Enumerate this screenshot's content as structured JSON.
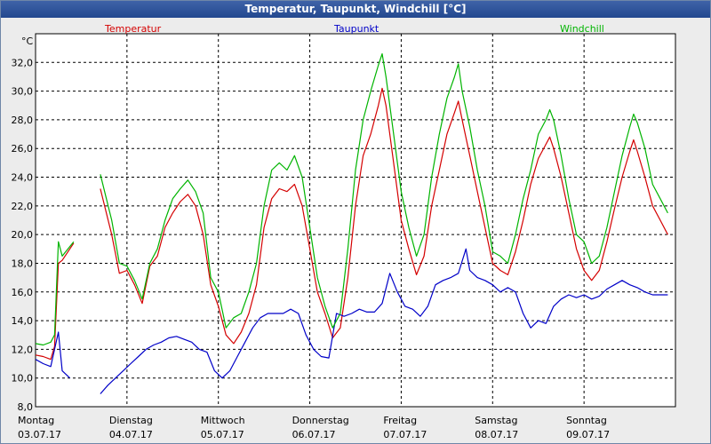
{
  "window": {
    "title": "Temperatur, Taupunkt, Windchill [°C]"
  },
  "chart_data": {
    "type": "line",
    "title": "Temperatur, Taupunkt, Windchill [°C]",
    "y_unit": "°C",
    "ylim": [
      8,
      34
    ],
    "ytick_values": [
      8,
      10,
      12,
      14,
      16,
      18,
      20,
      22,
      24,
      26,
      28,
      30,
      32
    ],
    "ytick_labels": [
      "8,0",
      "10,0",
      "12,0",
      "14,0",
      "16,0",
      "18,0",
      "20,0",
      "22,0",
      "24,0",
      "26,0",
      "28,0",
      "30,0",
      "32,0"
    ],
    "xlim_hours": [
      0,
      168
    ],
    "grid": true,
    "x_days": [
      {
        "day": "Montag",
        "date": "03.07.17"
      },
      {
        "day": "Dienstag",
        "date": "04.07.17"
      },
      {
        "day": "Mittwoch",
        "date": "05.07.17"
      },
      {
        "day": "Donnerstag",
        "date": "06.07.17"
      },
      {
        "day": "Freitag",
        "date": "07.07.17"
      },
      {
        "day": "Samstag",
        "date": "08.07.17"
      },
      {
        "day": "Sonntag",
        "date": "09.07.17"
      }
    ],
    "series": [
      {
        "name": "Temperatur",
        "color": "#d40000",
        "segments": [
          [
            [
              0,
              11.6
            ],
            [
              2,
              11.5
            ],
            [
              4,
              11.3
            ],
            [
              5,
              12.2
            ],
            [
              6,
              18.0
            ],
            [
              7,
              18.2
            ],
            [
              10,
              19.4
            ]
          ],
          [
            [
              17,
              23.2
            ],
            [
              20,
              20.0
            ],
            [
              22,
              17.3
            ],
            [
              24,
              17.5
            ],
            [
              26,
              16.5
            ],
            [
              28,
              15.2
            ],
            [
              30,
              17.8
            ],
            [
              32,
              18.5
            ],
            [
              34,
              20.5
            ],
            [
              36,
              21.5
            ],
            [
              38,
              22.3
            ],
            [
              40,
              22.8
            ],
            [
              42,
              22.0
            ],
            [
              44,
              20.0
            ],
            [
              46,
              16.5
            ],
            [
              48,
              15.0
            ],
            [
              50,
              13.0
            ],
            [
              52,
              12.4
            ],
            [
              54,
              13.2
            ],
            [
              56,
              14.5
            ],
            [
              58,
              16.5
            ],
            [
              60,
              20.5
            ],
            [
              62,
              22.5
            ],
            [
              64,
              23.2
            ],
            [
              66,
              23.0
            ],
            [
              68,
              23.5
            ],
            [
              70,
              22.0
            ],
            [
              72,
              19.0
            ],
            [
              74,
              16.0
            ],
            [
              76,
              14.5
            ],
            [
              78,
              12.8
            ],
            [
              80,
              13.5
            ],
            [
              82,
              17.0
            ],
            [
              84,
              22.0
            ],
            [
              86,
              25.5
            ],
            [
              88,
              27.0
            ],
            [
              90,
              29.0
            ],
            [
              91,
              30.2
            ],
            [
              92,
              29.0
            ],
            [
              94,
              25.0
            ],
            [
              96,
              21.0
            ],
            [
              98,
              19.0
            ],
            [
              100,
              17.2
            ],
            [
              102,
              18.5
            ],
            [
              104,
              22.0
            ],
            [
              106,
              24.5
            ],
            [
              108,
              27.0
            ],
            [
              110,
              28.5
            ],
            [
              111,
              29.3
            ],
            [
              112,
              28.0
            ],
            [
              114,
              25.5
            ],
            [
              116,
              23.0
            ],
            [
              118,
              20.5
            ],
            [
              120,
              18.0
            ],
            [
              122,
              17.5
            ],
            [
              124,
              17.2
            ],
            [
              126,
              18.8
            ],
            [
              128,
              21.0
            ],
            [
              130,
              23.5
            ],
            [
              132,
              25.3
            ],
            [
              134,
              26.3
            ],
            [
              135,
              26.8
            ],
            [
              136,
              26.0
            ],
            [
              138,
              24.0
            ],
            [
              140,
              21.5
            ],
            [
              142,
              19.0
            ],
            [
              144,
              17.5
            ],
            [
              146,
              16.8
            ],
            [
              148,
              17.5
            ],
            [
              150,
              19.5
            ],
            [
              152,
              21.8
            ],
            [
              154,
              24.0
            ],
            [
              156,
              25.8
            ],
            [
              157,
              26.6
            ],
            [
              158,
              25.8
            ],
            [
              160,
              24.0
            ],
            [
              162,
              22.0
            ],
            [
              164,
              21.0
            ],
            [
              166,
              20.0
            ]
          ]
        ]
      },
      {
        "name": "Taupunkt",
        "color": "#0000c8",
        "segments": [
          [
            [
              0,
              11.3
            ],
            [
              2,
              11.0
            ],
            [
              4,
              10.8
            ],
            [
              6,
              13.2
            ],
            [
              7,
              10.5
            ],
            [
              9,
              10.0
            ]
          ],
          [
            [
              17,
              8.9
            ],
            [
              19,
              9.5
            ],
            [
              21,
              10.0
            ],
            [
              23,
              10.5
            ],
            [
              25,
              11.0
            ],
            [
              27,
              11.5
            ],
            [
              29,
              12.0
            ],
            [
              31,
              12.3
            ],
            [
              33,
              12.5
            ],
            [
              35,
              12.8
            ],
            [
              37,
              12.9
            ],
            [
              39,
              12.7
            ],
            [
              41,
              12.5
            ],
            [
              43,
              12.0
            ],
            [
              45,
              11.8
            ],
            [
              47,
              10.5
            ],
            [
              49,
              10.0
            ],
            [
              51,
              10.5
            ],
            [
              53,
              11.5
            ],
            [
              55,
              12.5
            ],
            [
              57,
              13.5
            ],
            [
              59,
              14.2
            ],
            [
              61,
              14.5
            ],
            [
              63,
              14.5
            ],
            [
              65,
              14.5
            ],
            [
              67,
              14.8
            ],
            [
              69,
              14.5
            ],
            [
              71,
              13.0
            ],
            [
              73,
              12.0
            ],
            [
              75,
              11.5
            ],
            [
              77,
              11.4
            ],
            [
              79,
              14.5
            ],
            [
              81,
              14.3
            ],
            [
              83,
              14.5
            ],
            [
              85,
              14.8
            ],
            [
              87,
              14.6
            ],
            [
              89,
              14.6
            ],
            [
              91,
              15.2
            ],
            [
              93,
              17.3
            ],
            [
              95,
              16.0
            ],
            [
              97,
              15.0
            ],
            [
              99,
              14.8
            ],
            [
              101,
              14.3
            ],
            [
              103,
              15.0
            ],
            [
              105,
              16.5
            ],
            [
              107,
              16.8
            ],
            [
              109,
              17.0
            ],
            [
              111,
              17.3
            ],
            [
              113,
              19.0
            ],
            [
              114,
              17.5
            ],
            [
              116,
              17.0
            ],
            [
              118,
              16.8
            ],
            [
              120,
              16.5
            ],
            [
              122,
              16.0
            ],
            [
              124,
              16.3
            ],
            [
              126,
              16.0
            ],
            [
              128,
              14.5
            ],
            [
              130,
              13.5
            ],
            [
              132,
              14.0
            ],
            [
              134,
              13.8
            ],
            [
              136,
              15.0
            ],
            [
              138,
              15.5
            ],
            [
              140,
              15.8
            ],
            [
              142,
              15.6
            ],
            [
              144,
              15.8
            ],
            [
              146,
              15.5
            ],
            [
              148,
              15.7
            ],
            [
              150,
              16.2
            ],
            [
              152,
              16.5
            ],
            [
              154,
              16.8
            ],
            [
              156,
              16.5
            ],
            [
              158,
              16.3
            ],
            [
              160,
              16.0
            ],
            [
              162,
              15.8
            ],
            [
              164,
              15.8
            ],
            [
              166,
              15.8
            ]
          ]
        ]
      },
      {
        "name": "Windchill",
        "color": "#00b400",
        "segments": [
          [
            [
              0,
              12.4
            ],
            [
              2,
              12.3
            ],
            [
              4,
              12.5
            ],
            [
              5,
              13.0
            ],
            [
              6,
              19.5
            ],
            [
              7,
              18.5
            ],
            [
              10,
              19.5
            ]
          ],
          [
            [
              17,
              24.2
            ],
            [
              20,
              21.0
            ],
            [
              22,
              18.0
            ],
            [
              24,
              17.8
            ],
            [
              26,
              16.8
            ],
            [
              28,
              15.5
            ],
            [
              30,
              18.0
            ],
            [
              32,
              19.0
            ],
            [
              34,
              21.0
            ],
            [
              36,
              22.5
            ],
            [
              38,
              23.2
            ],
            [
              40,
              23.8
            ],
            [
              42,
              23.0
            ],
            [
              44,
              21.5
            ],
            [
              46,
              17.0
            ],
            [
              48,
              16.0
            ],
            [
              50,
              13.5
            ],
            [
              52,
              14.2
            ],
            [
              54,
              14.5
            ],
            [
              56,
              16.0
            ],
            [
              58,
              18.0
            ],
            [
              60,
              22.0
            ],
            [
              62,
              24.5
            ],
            [
              64,
              25.0
            ],
            [
              66,
              24.5
            ],
            [
              68,
              25.5
            ],
            [
              70,
              24.0
            ],
            [
              72,
              20.5
            ],
            [
              74,
              17.0
            ],
            [
              76,
              15.0
            ],
            [
              78,
              13.5
            ],
            [
              80,
              14.5
            ],
            [
              82,
              19.0
            ],
            [
              84,
              24.5
            ],
            [
              86,
              28.0
            ],
            [
              88,
              30.0
            ],
            [
              90,
              31.8
            ],
            [
              91,
              32.6
            ],
            [
              92,
              31.0
            ],
            [
              94,
              27.0
            ],
            [
              96,
              23.0
            ],
            [
              98,
              20.5
            ],
            [
              100,
              18.5
            ],
            [
              102,
              20.0
            ],
            [
              104,
              24.0
            ],
            [
              106,
              27.0
            ],
            [
              108,
              29.5
            ],
            [
              110,
              31.0
            ],
            [
              111,
              31.9
            ],
            [
              112,
              30.0
            ],
            [
              114,
              27.5
            ],
            [
              116,
              24.5
            ],
            [
              118,
              22.0
            ],
            [
              120,
              18.8
            ],
            [
              122,
              18.5
            ],
            [
              124,
              18.0
            ],
            [
              126,
              20.0
            ],
            [
              128,
              22.5
            ],
            [
              130,
              24.5
            ],
            [
              132,
              27.0
            ],
            [
              134,
              28.0
            ],
            [
              135,
              28.7
            ],
            [
              136,
              28.0
            ],
            [
              138,
              25.5
            ],
            [
              140,
              22.5
            ],
            [
              142,
              20.0
            ],
            [
              144,
              19.5
            ],
            [
              146,
              18.0
            ],
            [
              148,
              18.5
            ],
            [
              150,
              20.5
            ],
            [
              152,
              23.0
            ],
            [
              154,
              25.5
            ],
            [
              156,
              27.5
            ],
            [
              157,
              28.4
            ],
            [
              158,
              27.8
            ],
            [
              160,
              26.0
            ],
            [
              162,
              23.5
            ],
            [
              164,
              22.5
            ],
            [
              166,
              21.5
            ]
          ]
        ]
      }
    ]
  }
}
